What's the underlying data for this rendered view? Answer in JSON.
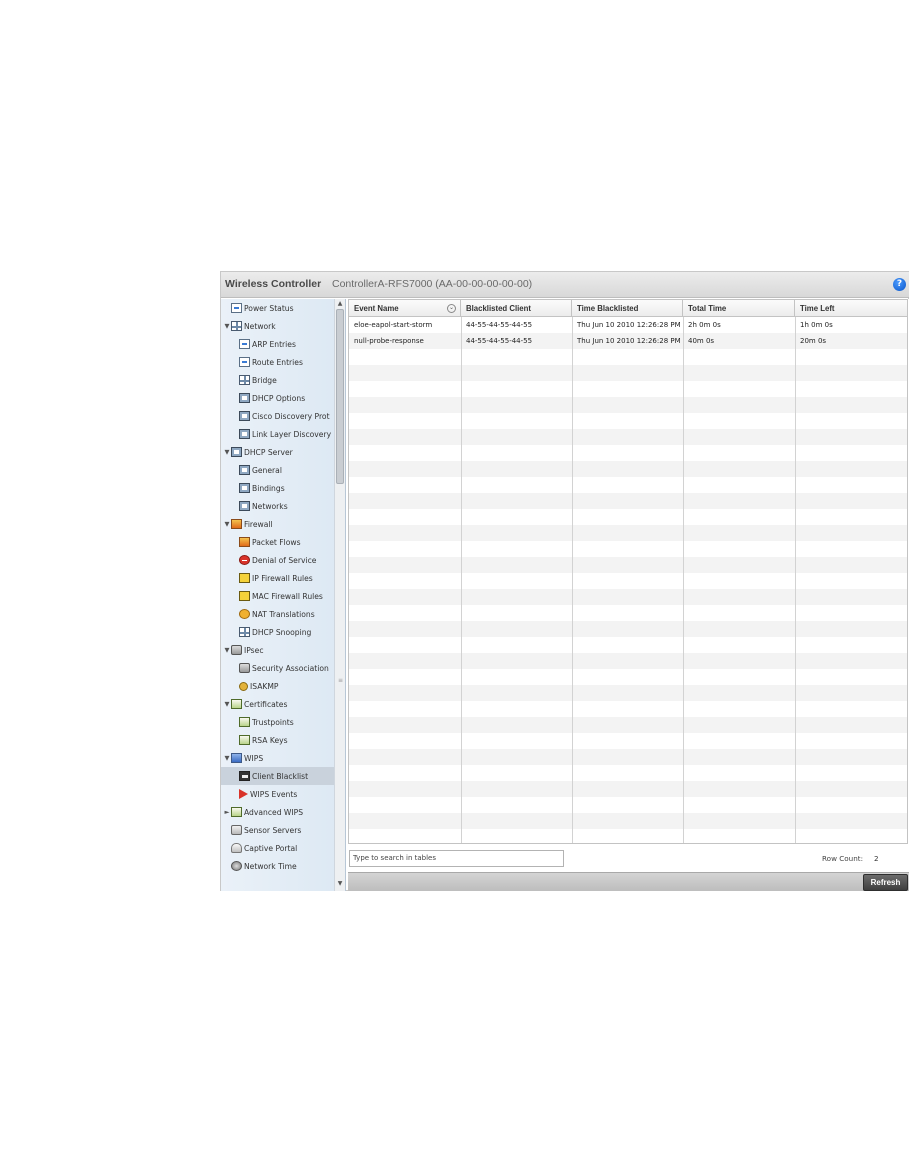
{
  "header": {
    "app_title": "Wireless Controller",
    "device": "ControllerA-RFS7000 (AA-00-00-00-00-00)",
    "help_glyph": "?"
  },
  "sidebar": {
    "items": [
      {
        "label": "Power Status",
        "icon": "power-status-icon",
        "indent": 1,
        "caret": ""
      },
      {
        "label": "Network",
        "icon": "network-icon",
        "indent": 0,
        "caret": "▼"
      },
      {
        "label": "ARP Entries",
        "icon": "arp-entries-icon",
        "indent": 2,
        "caret": ""
      },
      {
        "label": "Route Entries",
        "icon": "route-entries-icon",
        "indent": 2,
        "caret": ""
      },
      {
        "label": "Bridge",
        "icon": "bridge-icon",
        "indent": 2,
        "caret": ""
      },
      {
        "label": "DHCP Options",
        "icon": "dhcp-options-icon",
        "indent": 2,
        "caret": ""
      },
      {
        "label": "Cisco Discovery Prot",
        "icon": "cisco-discovery-icon",
        "indent": 2,
        "caret": ""
      },
      {
        "label": "Link Layer Discovery",
        "icon": "link-layer-discovery-icon",
        "indent": 2,
        "caret": ""
      },
      {
        "label": "DHCP Server",
        "icon": "dhcp-server-icon",
        "indent": 0,
        "caret": "▼"
      },
      {
        "label": "General",
        "icon": "general-icon",
        "indent": 2,
        "caret": ""
      },
      {
        "label": "Bindings",
        "icon": "bindings-icon",
        "indent": 2,
        "caret": ""
      },
      {
        "label": "Networks",
        "icon": "networks-icon",
        "indent": 2,
        "caret": ""
      },
      {
        "label": "Firewall",
        "icon": "firewall-icon",
        "indent": 0,
        "caret": "▼"
      },
      {
        "label": "Packet Flows",
        "icon": "packet-flows-icon",
        "indent": 2,
        "caret": ""
      },
      {
        "label": "Denial of Service",
        "icon": "denial-of-service-icon",
        "indent": 2,
        "caret": ""
      },
      {
        "label": "IP Firewall Rules",
        "icon": "ip-firewall-rules-icon",
        "indent": 2,
        "caret": ""
      },
      {
        "label": "MAC Firewall Rules",
        "icon": "mac-firewall-rules-icon",
        "indent": 2,
        "caret": ""
      },
      {
        "label": "NAT Translations",
        "icon": "nat-translations-icon",
        "indent": 2,
        "caret": ""
      },
      {
        "label": "DHCP Snooping",
        "icon": "dhcp-snooping-icon",
        "indent": 2,
        "caret": ""
      },
      {
        "label": "IPsec",
        "icon": "ipsec-icon",
        "indent": 0,
        "caret": "▼"
      },
      {
        "label": "Security Association",
        "icon": "security-association-icon",
        "indent": 2,
        "caret": ""
      },
      {
        "label": "ISAKMP",
        "icon": "isakmp-icon",
        "indent": 2,
        "caret": ""
      },
      {
        "label": "Certificates",
        "icon": "certificates-icon",
        "indent": 0,
        "caret": "▼"
      },
      {
        "label": "Trustpoints",
        "icon": "trustpoints-icon",
        "indent": 2,
        "caret": ""
      },
      {
        "label": "RSA Keys",
        "icon": "rsa-keys-icon",
        "indent": 2,
        "caret": ""
      },
      {
        "label": "WIPS",
        "icon": "wips-icon",
        "indent": 0,
        "caret": "▼"
      },
      {
        "label": "Client Blacklist",
        "icon": "client-blacklist-icon",
        "indent": 2,
        "caret": "",
        "selected": true
      },
      {
        "label": "WIPS Events",
        "icon": "wips-events-icon",
        "indent": 2,
        "caret": ""
      },
      {
        "label": "Advanced WIPS",
        "icon": "advanced-wips-icon",
        "indent": 0,
        "caret": "►"
      },
      {
        "label": "Sensor Servers",
        "icon": "sensor-servers-icon",
        "indent": 1,
        "caret": ""
      },
      {
        "label": "Captive Portal",
        "icon": "captive-portal-icon",
        "indent": 1,
        "caret": ""
      },
      {
        "label": "Network Time",
        "icon": "network-time-icon",
        "indent": 1,
        "caret": ""
      }
    ]
  },
  "table": {
    "columns": [
      "Event Name",
      "Blacklisted Client",
      "Time Blacklisted",
      "Total Time",
      "Time Left"
    ],
    "rows": [
      [
        "eloe-eapol-start-storm",
        "44-55-44-55-44-55",
        "Thu Jun 10 2010 12:26:28 PM",
        "2h 0m 0s",
        "1h 0m 0s"
      ],
      [
        "null-probe-response",
        "44-55-44-55-44-55",
        "Thu Jun 10 2010 12:26:28 PM",
        "40m 0s",
        "20m 0s"
      ]
    ]
  },
  "search": {
    "placeholder": "Type to search in tables"
  },
  "status": {
    "row_count_label": "Row Count:",
    "row_count": "2"
  },
  "footer": {
    "refresh_label": "Refresh"
  }
}
